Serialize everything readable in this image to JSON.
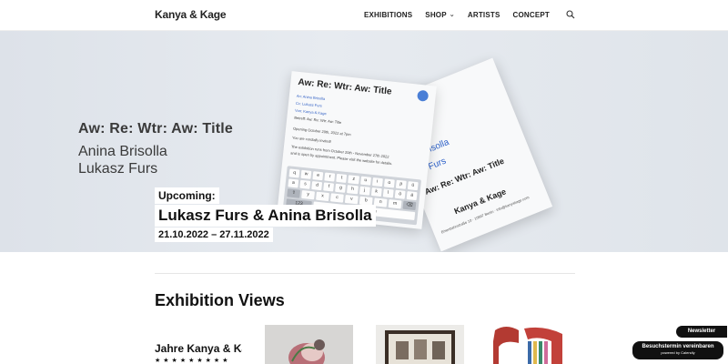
{
  "header": {
    "logo": "Kanya & Kage",
    "nav": [
      {
        "label": "EXHIBITIONS"
      },
      {
        "label": "SHOP",
        "has_dropdown": true
      },
      {
        "label": "ARTISTS"
      },
      {
        "label": "CONCEPT"
      }
    ],
    "search_icon": "search-icon"
  },
  "hero": {
    "title": "Aw: Re: Wtr: Aw: Title",
    "artist_1": "Anina Brisolla",
    "artist_2": "Lukasz Furs",
    "flyer_front": {
      "title": "Aw: Re: Wtr: Aw: Title",
      "lines": [
        "An: Anina Brisolla",
        "Cc: Lukasz Furs",
        "Von: Kanya & Kage",
        "Betreff: Aw: Re: Wtr: Aw: Title",
        "Opening October 20th, 2022 at 7pm",
        "You are cordially invited!",
        "The exhibition runs from October 20th - November 27th 2022",
        "and is open by appointment. Please visit the website for details."
      ],
      "keyboard_rows": [
        [
          "q",
          "w",
          "e",
          "r",
          "t",
          "z",
          "u",
          "i",
          "o",
          "p",
          "ü"
        ],
        [
          "a",
          "s",
          "d",
          "f",
          "g",
          "h",
          "j",
          "k",
          "l",
          "ö",
          "ä"
        ],
        [
          "⇧",
          "y",
          "x",
          "c",
          "v",
          "b",
          "n",
          "m",
          "⌫"
        ]
      ],
      "key_123": "123",
      "key_space": "Leerzeichen"
    },
    "flyer_back": {
      "blue_1": "Brisolla",
      "blue_2": "Furs",
      "title": "Aw: Re: Wtr: Aw: Title",
      "brand": "Kanya & Kage",
      "address": "Eisenbahnstraße 10 · 10997 Berlin · info@kanyakage.com"
    },
    "upcoming_label": "Upcoming:",
    "upcoming_names": "Lukasz Furs & Anina Brisolla",
    "upcoming_dates": "21.10.2022 – 27.11.2022"
  },
  "section": {
    "title": "Exhibition Views",
    "first_thumb_text": "Jahre  Kanya & Kage",
    "first_thumb_stars": "★★★★★★★★★"
  },
  "floating": {
    "newsletter": "Newsletter",
    "calendly_title": "Besuchstermin vereinbaren",
    "calendly_sub": "powered by Calendly"
  },
  "colors": {
    "accent_blue": "#2f62c9",
    "hero_bg": "#e3e7ed",
    "text_dark": "#222222"
  }
}
